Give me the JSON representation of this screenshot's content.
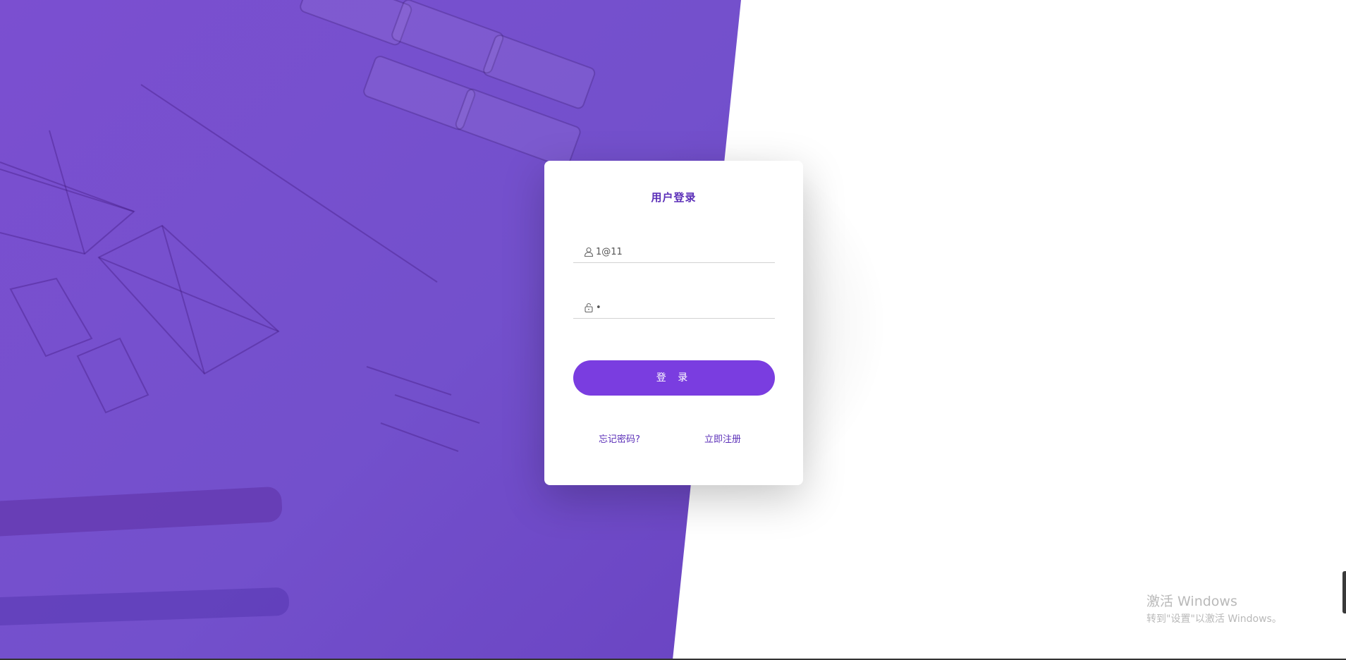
{
  "login": {
    "title": "用户登录",
    "username_value": "1@11",
    "password_value": "•",
    "submit_label": "登 录",
    "forgot_password_label": "忘记密码?",
    "register_label": "立即注册"
  },
  "icons": {
    "username": "user-icon",
    "password": "lock-icon"
  },
  "watermark": {
    "title": "激活 Windows",
    "subtitle": "转到\"设置\"以激活 Windows。"
  },
  "colors": {
    "brand_purple": "#7a3de0",
    "title_purple": "#5b2fb8",
    "background_purple": "#7350cc"
  }
}
